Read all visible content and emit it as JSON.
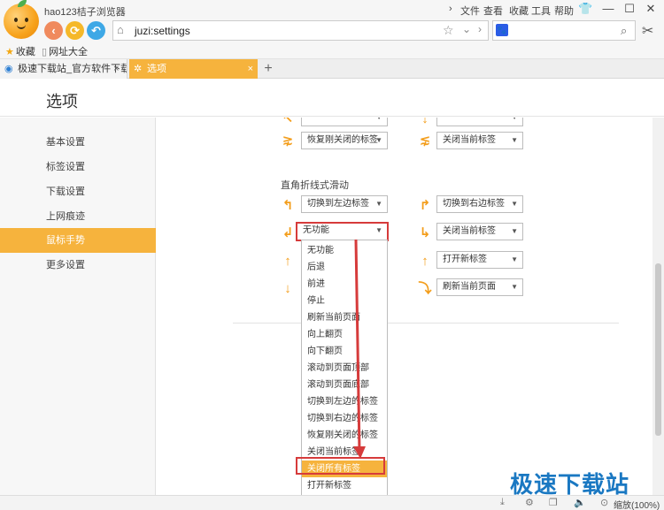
{
  "app": {
    "title": "hao123桔子浏览器"
  },
  "menu": {
    "file": "文件",
    "view": "查看",
    "favorites": "收藏",
    "tools": "工具",
    "help": "帮助"
  },
  "nav": {
    "back": "‹",
    "forward": "⟳",
    "undo": "↶"
  },
  "address": {
    "url": "juzi:settings"
  },
  "search": {
    "engine_badge": "🐾",
    "value": ""
  },
  "bookmarks": {
    "fav": "收藏",
    "nav": "网址大全"
  },
  "tabs": [
    {
      "label": "极速下载站_官方软件下载_绿",
      "close": "×"
    },
    {
      "label": "选项",
      "close": "×"
    }
  ],
  "new_tab": "+",
  "page": {
    "title": "选项"
  },
  "sidebar": {
    "items": [
      {
        "label": "基本设置"
      },
      {
        "label": "标签设置"
      },
      {
        "label": "下载设置"
      },
      {
        "label": "上网痕迹"
      },
      {
        "label": "鼠标手势"
      },
      {
        "label": "更多设置"
      }
    ]
  },
  "gestures": {
    "top_left_select": "",
    "top_right_select": "",
    "restore_left": "恢复刚关闭的标签",
    "close_current_right": "关闭当前标签",
    "section_title": "直角折线式滑动",
    "switch_left": "切换到左边标签",
    "switch_right": "切换到右边标签",
    "none_open": "无功能",
    "close_current": "关闭当前标签",
    "open_new": "打开新标签",
    "refresh_current": "刷新当前页面"
  },
  "dropdown": {
    "options": [
      "无功能",
      "后退",
      "前进",
      "停止",
      "刷新当前页面",
      "向上翻页",
      "向下翻页",
      "滚动到页面顶部",
      "滚动到页面底部",
      "切换到左边的标签",
      "切换到右边的标签",
      "恢复刚关闭的标签",
      "关闭当前标签",
      "关闭所有标签",
      "打开新标签"
    ],
    "selected": "关闭所有标签"
  },
  "status": {
    "zoom": "缩放(100%)"
  },
  "watermark": "极速下载站",
  "colors": {
    "accent": "#f6b33d",
    "highlight_border": "#d63b3b"
  }
}
